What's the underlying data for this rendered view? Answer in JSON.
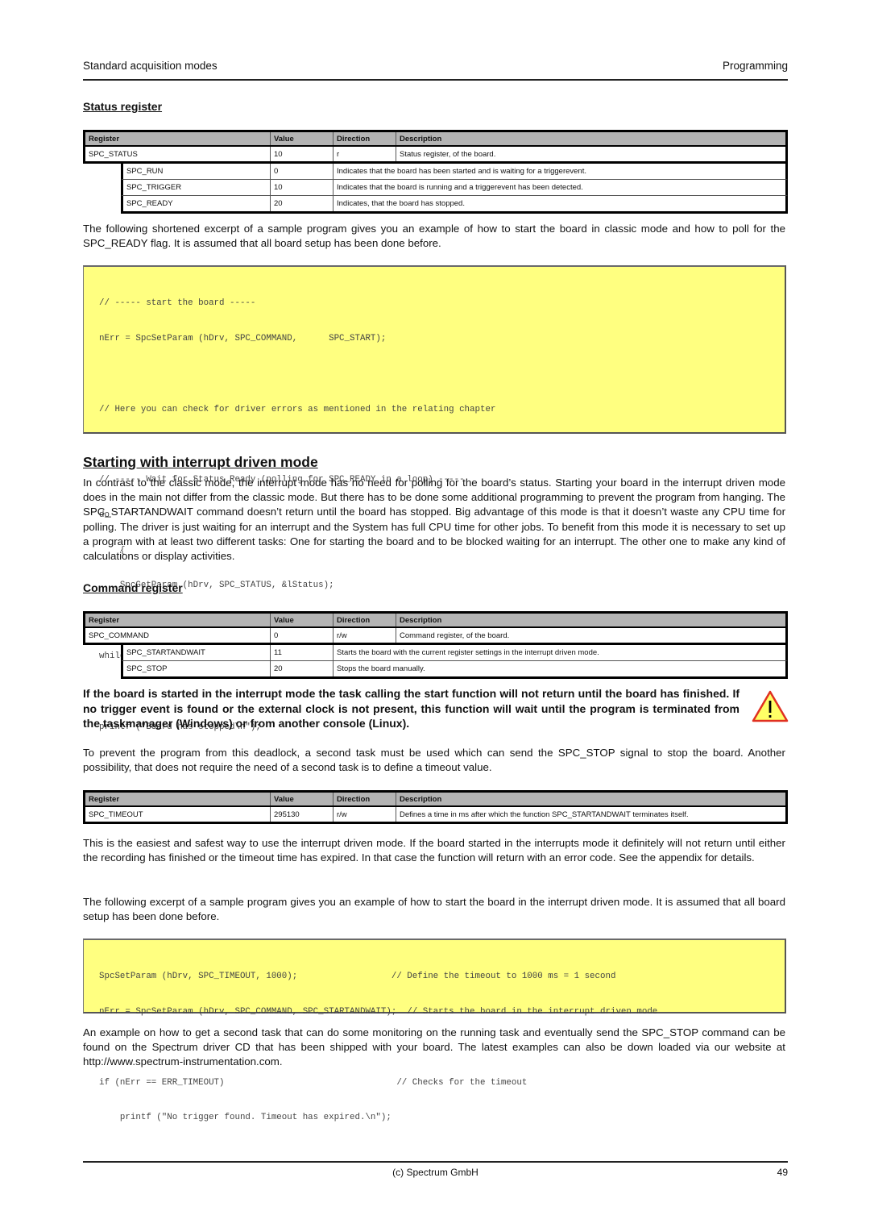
{
  "header": {
    "section": "Standard acquisition modes",
    "chapter": "Programming"
  },
  "status_register": {
    "heading": "Status register",
    "columns": [
      "Register",
      "Value",
      "Direction",
      "Description"
    ],
    "main": {
      "register": "SPC_STATUS",
      "value": "10",
      "direction": "r",
      "description": "Status register, of the board."
    },
    "subs": [
      {
        "register": "SPC_RUN",
        "value": "0",
        "description": "Indicates that the board has been started and is waiting for a triggerevent."
      },
      {
        "register": "SPC_TRIGGER",
        "value": "10",
        "description": "Indicates that the board is running and a triggerevent has been detected."
      },
      {
        "register": "SPC_READY",
        "value": "20",
        "description": "Indicates, that the board has stopped."
      }
    ]
  },
  "para_polling_intro": "The following shortened excerpt of a sample program gives you an example of how to start the board in classic mode and how to poll for the SPC_READY flag. It is assumed that all board setup has been done before.",
  "code1": {
    "lines": [
      "// ----- start the board -----",
      "nErr = SpcSetParam (hDrv, SPC_COMMAND,      SPC_START);",
      "",
      "// Here you can check for driver errors as mentioned in the relating chapter",
      "",
      "// ----- Wait for Status Ready (polling for SPC_READY in a loop) -----",
      "do",
      "    {",
      "    SpcGetParam (hDrv, SPC_STATUS, &lStatus);",
      "    }",
      "while (lStatus != SPC_READY);",
      "",
      "printf (\"Board has stopped\\n\");"
    ]
  },
  "interrupt_section": {
    "heading": "Starting with interrupt driven mode",
    "para": "In contrast to the classic mode, the interrupt mode has no need for polling for the board’s status. Starting your board in the interrupt driven mode does in the main not differ from the classic mode. But there has to be done some additional programming to prevent the program from hanging. The SPC_STARTANDWAIT command doesn’t return until the board has stopped. Big advantage of this mode is that it doesn’t waste any CPU time for polling. The driver is just waiting for an interrupt and the System has full CPU time for other jobs. To benefit from this mode it is necessary to set up a program with at least two different tasks: One for starting the board and to be blocked waiting for an interrupt. The other one to make any kind of calculations or display activities."
  },
  "command_register": {
    "heading": "Command register",
    "columns": [
      "Register",
      "Value",
      "Direction",
      "Description"
    ],
    "main": {
      "register": "SPC_COMMAND",
      "value": "0",
      "direction": "r/w",
      "description": "Command register, of the board."
    },
    "subs": [
      {
        "register": "SPC_STARTANDWAIT",
        "value": "11",
        "description": "Starts the board with the current register settings in the interrupt driven mode."
      },
      {
        "register": "SPC_STOP",
        "value": "20",
        "description": "Stops the board manually."
      }
    ]
  },
  "warning": {
    "icon": "warning-triangle-icon",
    "text": "If the board is started in the interrupt mode  the task calling the start function will not return until the board has finished. If no trigger event is found or the external clock is not present, this function will wait until the program is terminated from the taskmanager (Windows) or from another console (Linux).",
    "colors": {
      "fill": "#ffff66",
      "border": "#e03020"
    }
  },
  "para_deadlock": "To prevent the program from this deadlock, a second task must be used which can send the SPC_STOP signal to stop the board. Another possibility, that does not require the need of a second task is to define a timeout value.",
  "timeout_register": {
    "columns": [
      "Register",
      "Value",
      "Direction",
      "Description"
    ],
    "main": {
      "register": "SPC_TIMEOUT",
      "value": "295130",
      "direction": "r/w",
      "description": "Defines a time in ms after which the function SPC_STARTANDWAIT terminates itself."
    }
  },
  "para_easiest": "This is the easiest and safest way to use the interrupt driven mode. If the board started in the interrupts mode it definitely will not return until either the recording has finished or the timeout time has expired. In that case the function will return with an error code. See the appendix for details.",
  "para_excerpt2": "The following excerpt of a sample program gives you an example of how to start the board in the interrupt driven mode. It is assumed that all board setup has been done before.",
  "code2": {
    "lines": [
      "SpcSetParam (hDrv, SPC_TIMEOUT, 1000);                  // Define the timeout to 1000 ms = 1 second",
      "nErr = SpcSetParam (hDrv, SPC_COMMAND, SPC_STARTANDWAIT);  // Starts the board in the interrupt driven mode",
      "",
      "if (nErr == ERR_TIMEOUT)                                 // Checks for the timeout",
      "    printf (\"No trigger found. Timeout has expired.\\n\");"
    ]
  },
  "para_example": "An example on how to get a second task that can do some monitoring on the running task and eventually send the SPC_STOP command can be found on the Spectrum driver CD that has been shipped with your board. The latest examples can also be down loaded via our website at http://www.spectrum-instrumentation.com.",
  "footer": {
    "copyright": "(c) Spectrum GmbH",
    "page_number": "49"
  },
  "colors": {
    "code_background": "#ffff80",
    "table_header": "#b4b4b4"
  }
}
